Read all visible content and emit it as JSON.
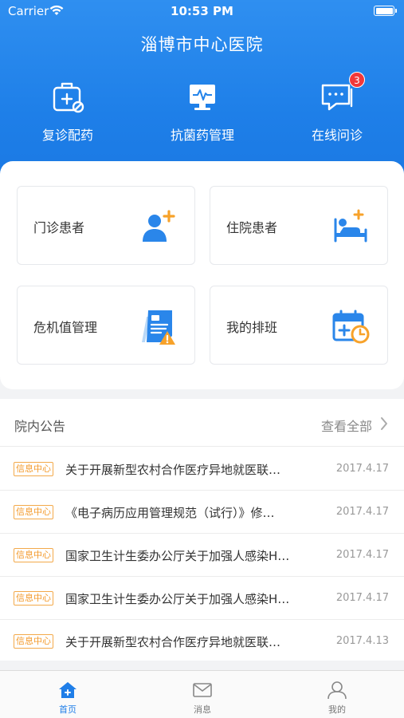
{
  "status_bar": {
    "carrier": "Carrier",
    "time": "10:53 PM"
  },
  "header": {
    "title": "淄博市中心医院"
  },
  "quick_actions": [
    {
      "label": "复诊配药",
      "icon": "medical-bag-icon"
    },
    {
      "label": "抗菌药管理",
      "icon": "monitor-pulse-icon"
    },
    {
      "label": "在线问诊",
      "icon": "chat-bubble-icon",
      "badge": "3"
    }
  ],
  "tiles": [
    {
      "label": "门诊患者",
      "icon": "add-patient-icon"
    },
    {
      "label": "住院患者",
      "icon": "hospital-bed-icon"
    },
    {
      "label": "危机值管理",
      "icon": "document-warning-icon"
    },
    {
      "label": "我的排班",
      "icon": "calendar-clock-icon"
    }
  ],
  "notices": {
    "title": "院内公告",
    "view_all": "查看全部",
    "items": [
      {
        "tag": "信息中心",
        "title": "关于开展新型农村合作医疗异地就医联…",
        "date": "2017.4.17"
      },
      {
        "tag": "信息中心",
        "title": "《电子病历应用管理规范（试行）》修…",
        "date": "2017.4.17"
      },
      {
        "tag": "信息中心",
        "title": "国家卫生计生委办公厅关于加强人感染H…",
        "date": "2017.4.17"
      },
      {
        "tag": "信息中心",
        "title": "国家卫生计生委办公厅关于加强人感染H…",
        "date": "2017.4.17"
      },
      {
        "tag": "信息中心",
        "title": "关于开展新型农村合作医疗异地就医联…",
        "date": "2017.4.13"
      }
    ]
  },
  "tabbar": [
    {
      "label": "首页",
      "icon": "home-icon",
      "active": true
    },
    {
      "label": "消息",
      "icon": "envelope-icon",
      "active": false
    },
    {
      "label": "我的",
      "icon": "user-icon",
      "active": false
    }
  ],
  "colors": {
    "brand": "#1e7fe8",
    "tag": "#f39a2b",
    "badge": "#f2383a",
    "icon_orange": "#f7a22a"
  }
}
